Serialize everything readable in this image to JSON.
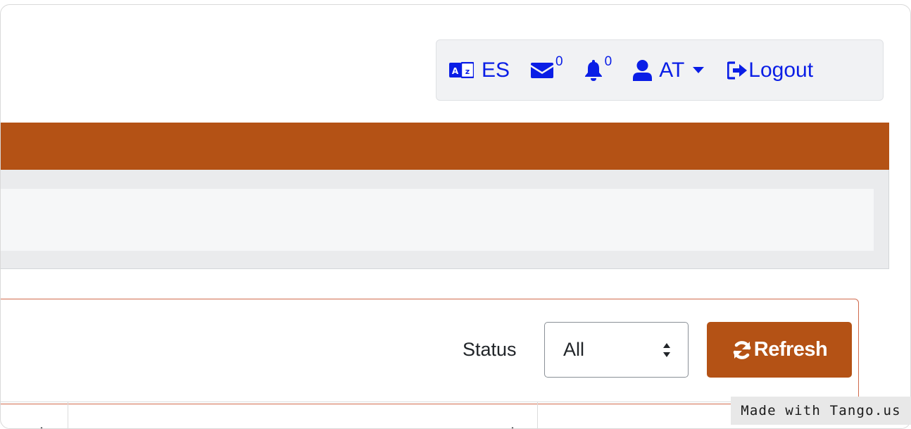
{
  "nav": {
    "language": "ES",
    "messages_count": "0",
    "notifications_count": "0",
    "user": "AT",
    "logout": "Logout"
  },
  "filter": {
    "status_label": "Status",
    "status_value": "All"
  },
  "buttons": {
    "refresh": "Refresh"
  },
  "watermark": "Made with Tango.us",
  "colors": {
    "brand_orange": "#b45215",
    "nav_link": "#0a1ee6"
  },
  "icons": [
    "language-icon",
    "envelope-icon",
    "bell-icon",
    "user-icon",
    "caret-down-icon",
    "logout-icon",
    "refresh-icon",
    "sort-icon"
  ]
}
